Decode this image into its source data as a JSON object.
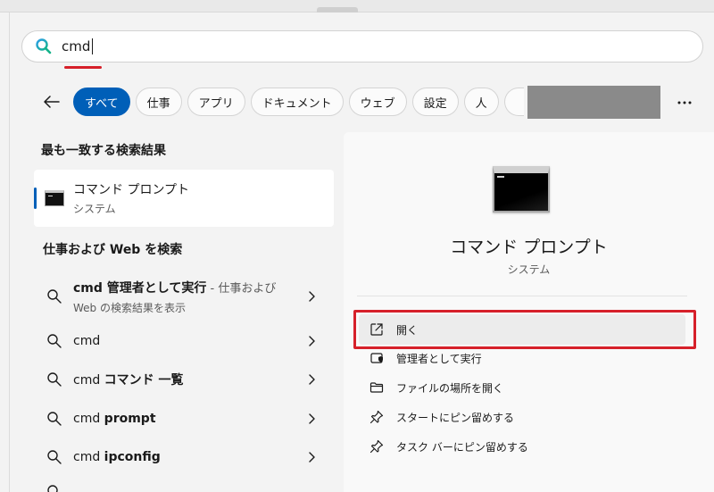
{
  "search": {
    "query": "cmd"
  },
  "filters": {
    "items": [
      "すべて",
      "仕事",
      "アプリ",
      "ドキュメント",
      "ウェブ",
      "設定",
      "人"
    ],
    "active_index": 0
  },
  "best_match": {
    "heading": "最も一致する検索結果",
    "title": "コマンド プロンプト",
    "subtitle": "システム"
  },
  "web_section": {
    "heading": "仕事および Web を検索",
    "results": [
      {
        "bold": "cmd 管理者として実行",
        "suffix": " - 仕事および",
        "line2": "Web の検索結果を表示"
      },
      {
        "bold": "",
        "plain": "cmd"
      },
      {
        "bold": "コマンド 一覧",
        "prefix": "cmd "
      },
      {
        "bold": "prompt",
        "prefix": "cmd "
      },
      {
        "bold": "ipconfig",
        "prefix": "cmd "
      }
    ]
  },
  "detail": {
    "title": "コマンド プロンプト",
    "subtitle": "システム",
    "actions": [
      {
        "label": "開く",
        "icon": "open-external-icon"
      },
      {
        "label": "管理者として実行",
        "icon": "shield-admin-icon"
      },
      {
        "label": "ファイルの場所を開く",
        "icon": "folder-icon"
      },
      {
        "label": "スタートにピン留めする",
        "icon": "pin-icon"
      },
      {
        "label": "タスク バーにピン留めする",
        "icon": "pin-icon"
      }
    ]
  },
  "colors": {
    "accent": "#005fb8",
    "annotation_red": "#d6202a"
  }
}
